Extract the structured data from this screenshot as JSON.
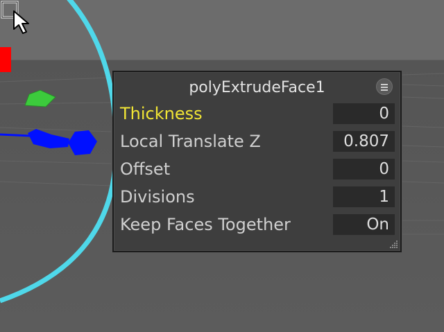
{
  "hud": {
    "title": "polyExtrudeFace1",
    "attributes": [
      {
        "label": "Thickness",
        "value": "0",
        "active": true
      },
      {
        "label": "Local Translate Z",
        "value": "0.807",
        "active": false
      },
      {
        "label": "Offset",
        "value": "0",
        "active": false
      },
      {
        "label": "Divisions",
        "value": "1",
        "active": false
      },
      {
        "label": "Keep Faces Together",
        "value": "On",
        "active": false
      }
    ]
  },
  "colors": {
    "active_label": "#f1e535",
    "manipulator_ring": "#4fd8ea",
    "manipulator_axis_z": "#0010ff",
    "manipulator_axis_y": "#3ccb3c",
    "manipulator_axis_x": "#ff0000"
  },
  "icons": [
    "menu-icon",
    "resize-grip-icon",
    "mouse-cursor-icon"
  ]
}
